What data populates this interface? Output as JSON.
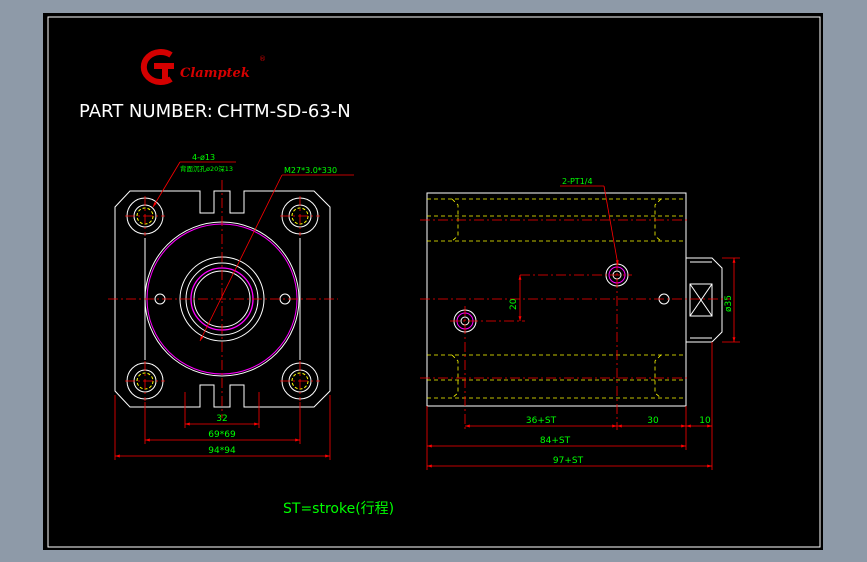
{
  "logo": {
    "text": "Clamptek",
    "mark": "G-clamp-logo",
    "registered": "®"
  },
  "part_number": {
    "label": "PART NUMBER:",
    "value": "CHTM-SD-63-N"
  },
  "front_view": {
    "hole_callout_1": "4-ø13",
    "hole_callout_2": "背面沉孔ø20深13",
    "thread_callout": "M27*3.0*330",
    "dim_inner": "32",
    "dim_middle": "69*69",
    "dim_outer": "94*94"
  },
  "side_view": {
    "port_callout": "2-PT1/4",
    "dim_vertical_port": "20",
    "dim_rod_dia": "ø35",
    "dim_stroke_a": "36+ST",
    "dim_b": "30",
    "dim_c": "10",
    "dim_body": "84+ST",
    "dim_total": "97+ST"
  },
  "note": "ST=stroke(行程)",
  "colors": {
    "background": "#000000",
    "frame": "#ffffff",
    "outline": "#ffffff",
    "hidden": "#ffff00",
    "center": "#ff0000",
    "dimension": "#00ff00",
    "thread": "#ff00ff",
    "logo": "#d40000"
  }
}
